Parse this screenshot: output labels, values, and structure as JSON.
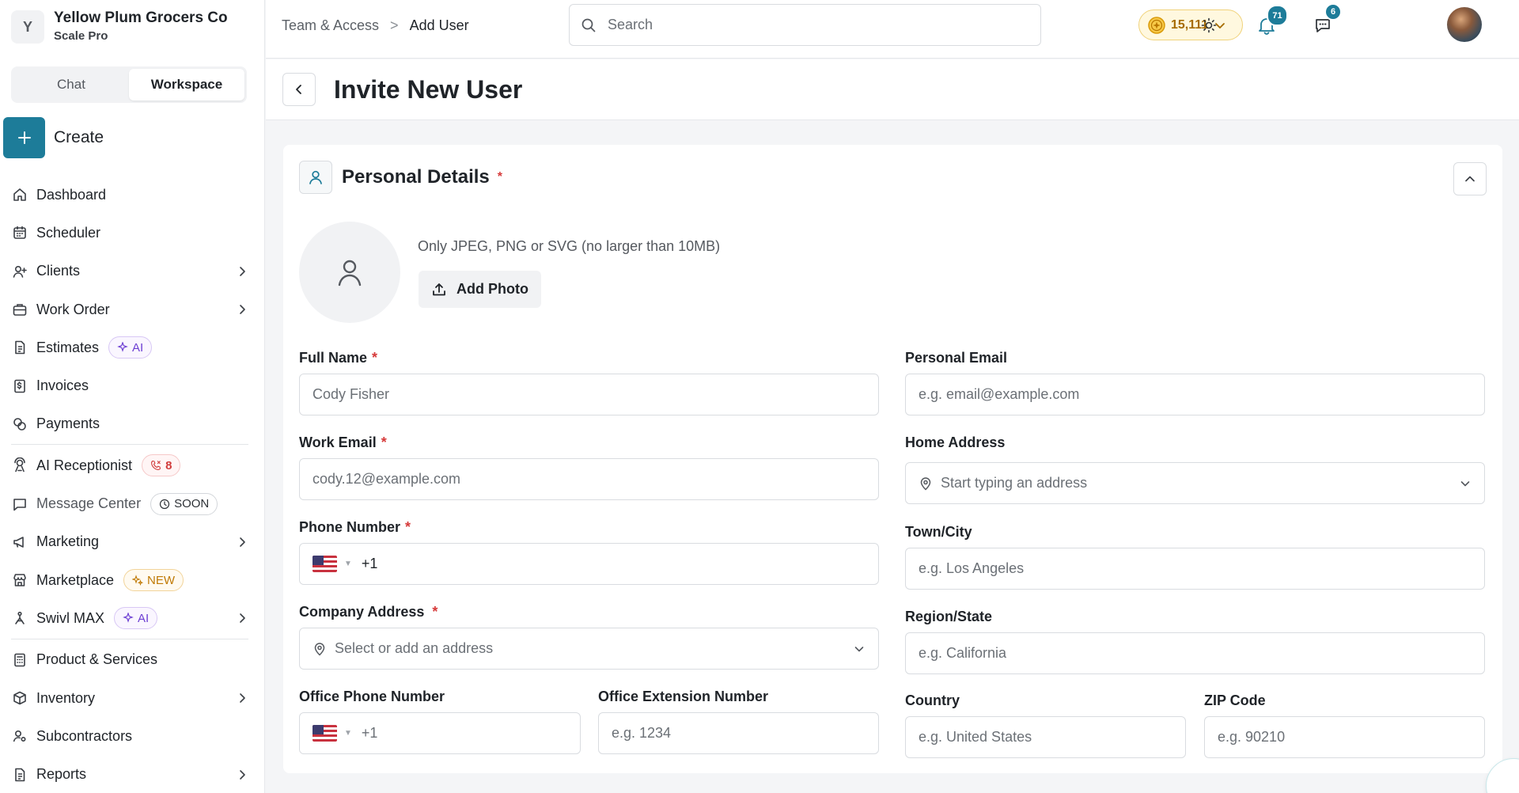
{
  "org": {
    "initial": "Y",
    "name": "Yellow Plum Grocers Co",
    "plan": "Scale Pro"
  },
  "mode_tabs": [
    {
      "label": "Chat",
      "active": false
    },
    {
      "label": "Workspace",
      "active": true
    }
  ],
  "create": {
    "label": "Create"
  },
  "nav": {
    "dashboard": "Dashboard",
    "scheduler": "Scheduler",
    "clients": "Clients",
    "work_order": "Work Order",
    "estimates": "Estimates",
    "estimates_badge": "AI",
    "invoices": "Invoices",
    "payments": "Payments",
    "ai_receptionist": "AI Receptionist",
    "ai_receptionist_badge": "8",
    "message_center": "Message Center",
    "message_center_badge": "SOON",
    "marketing": "Marketing",
    "marketplace": "Marketplace",
    "marketplace_badge": "NEW",
    "swivl_max": "Swivl MAX",
    "swivl_max_badge": "AI",
    "products": "Product & Services",
    "inventory": "Inventory",
    "subcontractors": "Subcontractors",
    "reports": "Reports"
  },
  "breadcrumb": {
    "parent": "Team & Access",
    "separator": ">",
    "current": "Add User"
  },
  "search": {
    "placeholder": "Search"
  },
  "credits": {
    "value": "15,111"
  },
  "notifications": {
    "count": "71"
  },
  "messages": {
    "count": "6"
  },
  "page": {
    "title": "Invite New User"
  },
  "section": {
    "title": "Personal Details",
    "required_mark": "*",
    "photo_hint": "Only JPEG, PNG or SVG (no larger than 10MB)",
    "add_photo_label": "Add Photo"
  },
  "fields": {
    "full_name": {
      "label": "Full Name",
      "required": "*",
      "placeholder": "Cody Fisher"
    },
    "personal_email": {
      "label": "Personal Email",
      "placeholder": "e.g. email@example.com"
    },
    "work_email": {
      "label": "Work Email",
      "required": "*",
      "placeholder": "cody.12@example.com"
    },
    "home_address": {
      "label": "Home Address",
      "placeholder": "Start typing an address"
    },
    "phone": {
      "label": "Phone Number",
      "required": "*",
      "dial_code": "+1"
    },
    "town": {
      "label": "Town/City",
      "placeholder": "e.g. Los Angeles"
    },
    "company_address": {
      "label": "Company Address",
      "required": "*",
      "placeholder": "Select or add an address"
    },
    "region": {
      "label": "Region/State",
      "placeholder": "e.g. California"
    },
    "office_phone": {
      "label": "Office Phone Number",
      "dial_code": "+1"
    },
    "office_ext": {
      "label": "Office Extension Number",
      "placeholder": "e.g. 1234"
    },
    "country": {
      "label": "Country",
      "placeholder": "e.g. United States"
    },
    "zip": {
      "label": "ZIP Code",
      "placeholder": "e.g. 90210"
    }
  },
  "colors": {
    "accent": "#1d7c99",
    "required": "#d63a3a",
    "ai_badge": "#6d3fd3",
    "credits": "#a66b00"
  }
}
